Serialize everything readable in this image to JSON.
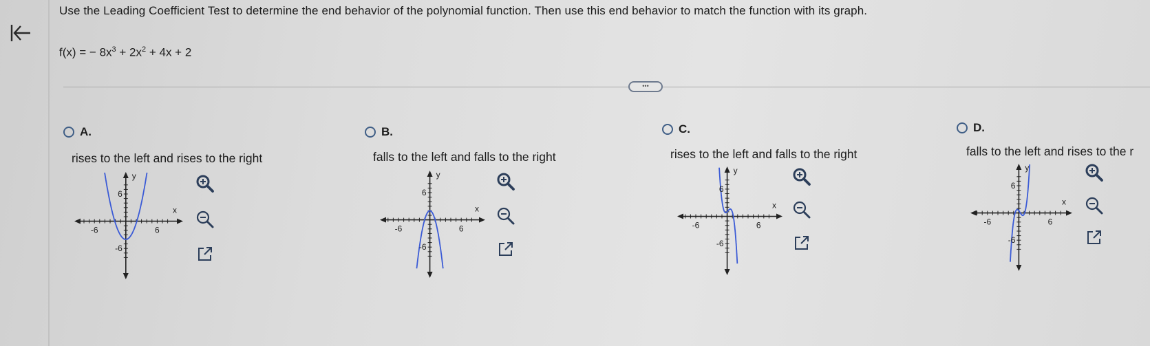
{
  "question": {
    "prompt": "Use the Leading Coefficient Test to determine the end behavior of the polynomial function. Then use this end behavior to match the function with its graph.",
    "function": {
      "lhs": "f(x) = − 8x",
      "e1": "3",
      "mid": " + 2x",
      "e2": "2",
      "rest": " + 4x + 2"
    },
    "more_label": "•••"
  },
  "options": [
    {
      "letter": "A.",
      "description": "rises to the left and rises to the right",
      "graph": {
        "x_label": "x",
        "y_label": "y",
        "x_neg": "-6",
        "x_pos": "6",
        "y_pos": "6",
        "y_neg": "-6"
      }
    },
    {
      "letter": "B.",
      "description": "falls to the left and falls to the right",
      "graph": {
        "x_label": "x",
        "y_label": "y",
        "x_neg": "-6",
        "x_pos": "6",
        "y_pos": "6",
        "y_neg": "-6"
      }
    },
    {
      "letter": "C.",
      "description": "rises to the left and falls to the right",
      "graph": {
        "x_label": "x",
        "y_label": "y",
        "x_neg": "-6",
        "x_pos": "6",
        "y_pos": "6",
        "y_neg": "-6"
      }
    },
    {
      "letter": "D.",
      "description": "falls to the left and rises to the r",
      "graph": {
        "x_label": "x",
        "y_label": "y",
        "x_neg": "-6",
        "x_pos": "6",
        "y_pos": "6",
        "y_neg": "-6"
      }
    }
  ],
  "icons": {
    "back": "back-to-start-icon",
    "zoom_in": "zoom-in-icon",
    "zoom_out": "zoom-out-icon",
    "popout": "open-new-window-icon"
  },
  "colors": {
    "curve": "#3b5bd6",
    "axis": "#222222",
    "accent": "#3f5e86"
  }
}
